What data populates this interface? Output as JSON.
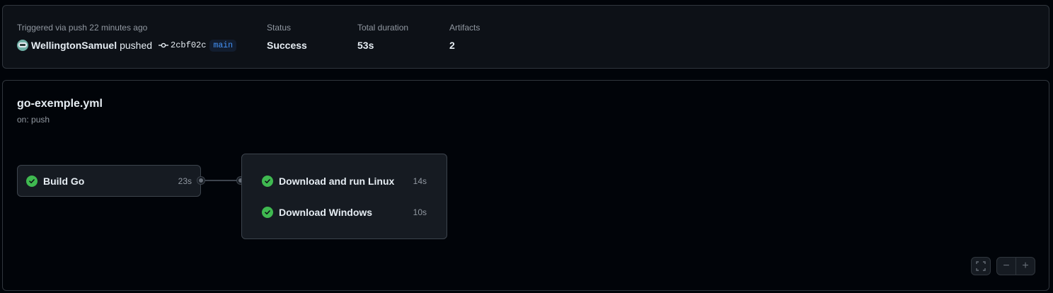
{
  "summary": {
    "trigger_text": "Triggered via push 22 minutes ago",
    "actor": "WellingtonSamuel",
    "action": "pushed",
    "commit_sha": "2cbf02c",
    "branch": "main",
    "status_label": "Status",
    "status_value": "Success",
    "duration_label": "Total duration",
    "duration_value": "53s",
    "artifacts_label": "Artifacts",
    "artifacts_value": "2"
  },
  "workflow": {
    "name": "go-exemple.yml",
    "trigger": "on: push"
  },
  "jobs": [
    {
      "name": "Build Go",
      "duration": "23s",
      "status": "success"
    },
    {
      "name": "Download and run Linux",
      "duration": "14s",
      "status": "success"
    },
    {
      "name": "Download Windows",
      "duration": "10s",
      "status": "success"
    }
  ],
  "controls": {
    "fullscreen_icon": "fullscreen-icon",
    "zoom_out_icon": "zoom-out-icon",
    "zoom_in_icon": "zoom-in-icon",
    "zoom_out_label": "−",
    "zoom_in_label": "+"
  },
  "colors": {
    "success": "#3fb950",
    "accent": "#4493f8",
    "background": "#010409"
  }
}
